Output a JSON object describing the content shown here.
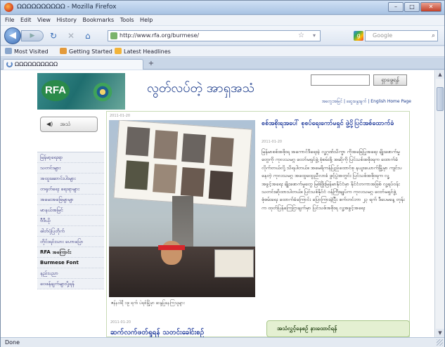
{
  "window": {
    "title": "ΩΩΩΩΩΩΩΩΩΩ - Mozilla Firefox",
    "controls": {
      "min": "–",
      "max": "□",
      "close": "✕"
    }
  },
  "menu": [
    "File",
    "Edit",
    "View",
    "History",
    "Bookmarks",
    "Tools",
    "Help"
  ],
  "nav": {
    "url": "http://www.rfa.org/burmese/",
    "search_placeholder": "Google",
    "back_icon": "◀",
    "reload_icon": "↻",
    "stop_icon": "✕",
    "home_icon": "⌂"
  },
  "bookmarks": [
    "Most Visited",
    "Getting Started",
    "Latest Headlines"
  ],
  "tab": {
    "label": "ΩΩΩΩΩΩΩΩΩΩ",
    "add": "+"
  },
  "status": "Done",
  "page": {
    "logo_text": "RFA",
    "site_title": "လွတ်လပ်တဲ့ အာရှအသံ",
    "search_button": "ရှာဖွေရန်",
    "header_links": "အတွေးအမြင် | ဆွေးနွေးချက် | English Home Page",
    "audio_label": "အသံ",
    "sidebar": [
      {
        "label": "မြန်မာ့ရေးရာ",
        "bold": false
      },
      {
        "label": "သတင်းများ",
        "bold": false
      },
      {
        "label": "အထူးဆောင်းပါးများ",
        "bold": false
      },
      {
        "label": "တရုတ်ရေး ရေးရာများ",
        "bold": false
      },
      {
        "label": "အမေးအဖြေမျာမျာ",
        "bold": false
      },
      {
        "label": "မာနယ်အမြင်",
        "bold": false
      },
      {
        "label": "ဗီဒီယို",
        "bold": false
      },
      {
        "label": "ဓါတ်ပုံပြတိုက်",
        "bold": false
      },
      {
        "label": "တိုင်းရင်းသား ဟောပြော",
        "bold": false
      },
      {
        "label": "RFA အကြောင်း",
        "bold": true
      },
      {
        "label": "Burmese Font",
        "bold": true
      },
      {
        "label": "နည်းပညာ",
        "bold": false
      },
      {
        "label": "ဝေဖန်ချက်များပို့ရန်",
        "bold": false
      }
    ],
    "feature": {
      "date": "2011-01-20",
      "headline": "စစ်အစိုးရအပေါ် စုစပ်ရေးကော်မရှင် ဖွဲ့ပို့ပြင်အစ်ထောက်ခံ",
      "date2": "2011-01-20",
      "body": "မြန်မာစစ်အစိုးရ အကောင်ဒီရေးခဲ့ လူ့ဂုဏ်သိက္ခာ ကိုအခြေပြုအရေး ချိုးဖောက်မှုတွေကို ကုလသမဂ္ဂ ဝေဘ်မရှင်ဖွဲ့ စုံစမ်းဖို့ အဆိုကို ပြင်သစ်အစိုးရက ထောက်ခံလိုက်တယ်လို့ သိရပါတယ်။ အမေရိကန်ပြည်ထောင်စု နယူးယောက်မြို့မှာ ကျင်းပနေတဲ့ ကုလသမဂ္ဂ အထွေထွေညီလာခံ ဖွင့်ပွဲအတွင်း ပြင်သစ်အစိုးရက လူ့အခွင့်အရေး ချိုးဖောက်မှုတွေ မြစ်ဖြိုးမြန်မာနိုင်ငံမှာ နိုင်ငံတကာအဖြစ် လူ့ရပ်ဝန်းသတင်းဆိုထားပါတယ်။ ပြင်သစ်နိုင်ငံ ဝန်ကြီးချုပ်က ကုလသမဂ္ဂ ဝေဘ်မရှင်ဖွဲ့ စုံစမ်းရေး ထောက်ခံကြောင်း ပြောကြားခဲ့ပြီး စက်တင်ဘာ ၂၃ ရက် ဒီပေမနေ့ တုန်းက ထုတ်ပြန်ကြေငြာချက်မှာ ပြင်သစ်အစိုးရ လူ့အခွင့်အရေး",
      "caption": "ဇန်နဝါရီ ၁၉ ရက်၊ ပဲရစ်မြို့မှာ ဆန္ဒပြနေကြသူများ"
    },
    "bottom_date": "2011-01-20",
    "bottom_headline": "ဆက်လက်ဖတ်ရှုရန် သတင်းခေါင်းစဉ်",
    "green_box": "အသံလွှင့်နေစဉ် နားထောင်ရန်"
  }
}
